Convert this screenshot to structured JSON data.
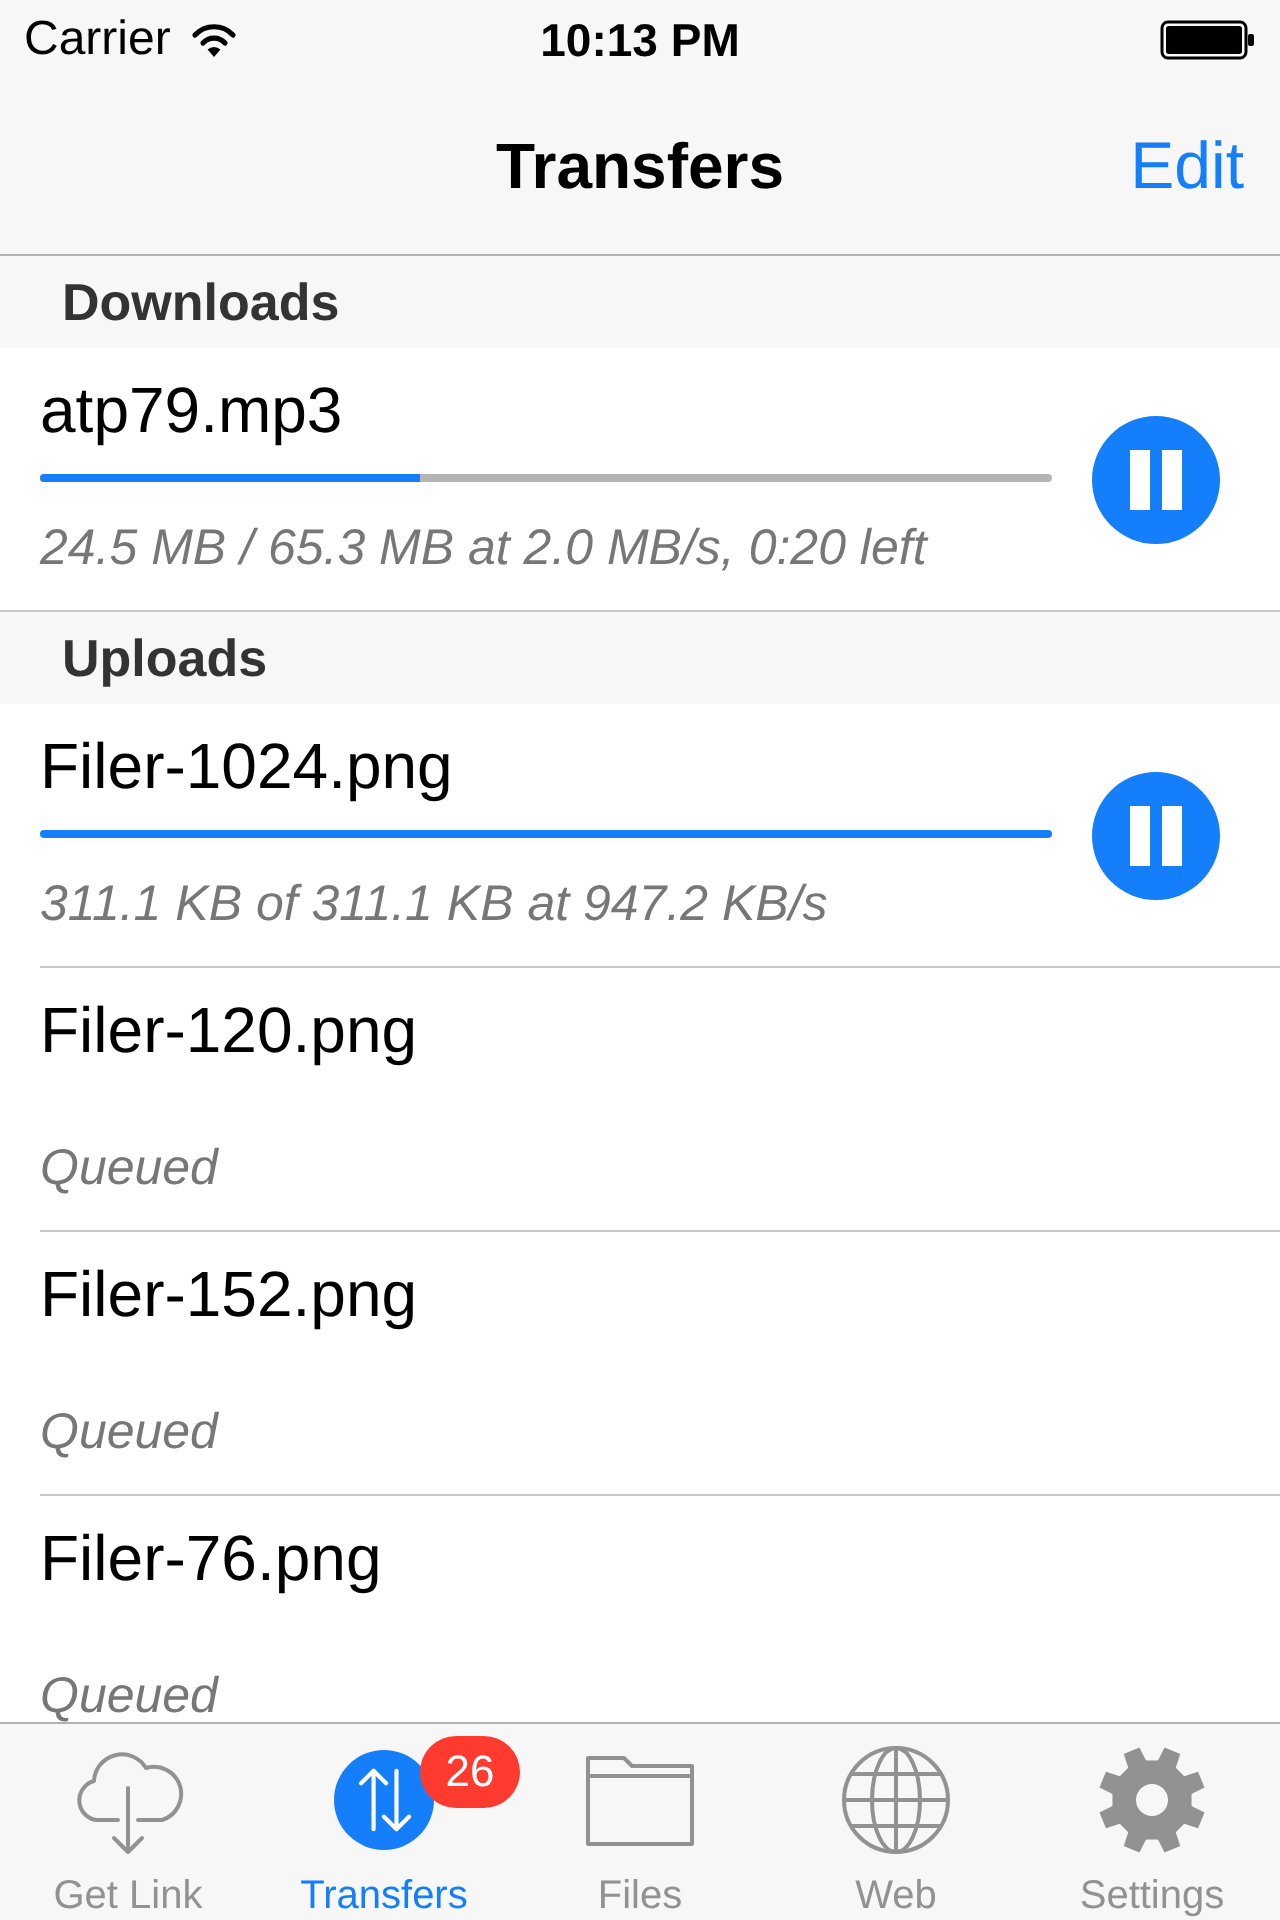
{
  "status_bar": {
    "carrier": "Carrier",
    "time": "10:13 PM"
  },
  "nav": {
    "title": "Transfers",
    "edit": "Edit"
  },
  "sections": [
    {
      "header": "Downloads",
      "items": [
        {
          "kind": "active",
          "name": "atp79.mp3",
          "level": 0.375,
          "detail": "24.5 MB / 65.3 MB at 2.0 MB/s, 0:20 left"
        }
      ]
    },
    {
      "header": "Uploads",
      "items": [
        {
          "kind": "active",
          "name": "Filer-1024.png",
          "level": 1,
          "detail": "311.1 KB of 311.1 KB at 947.2 KB/s"
        },
        {
          "kind": "queued",
          "name": "Filer-120.png",
          "detail": "Queued"
        },
        {
          "kind": "queued",
          "name": "Filer-152.png",
          "detail": "Queued"
        },
        {
          "kind": "queued",
          "name": "Filer-76.png",
          "detail": "Queued"
        }
      ]
    }
  ],
  "tab_bar": {
    "tabs": [
      {
        "label": "Get Link",
        "selected": false
      },
      {
        "label": "Transfers",
        "selected": true,
        "badge": "26"
      },
      {
        "label": "Files",
        "selected": false
      },
      {
        "label": "Web",
        "selected": false
      },
      {
        "label": "Settings",
        "selected": false
      }
    ]
  }
}
